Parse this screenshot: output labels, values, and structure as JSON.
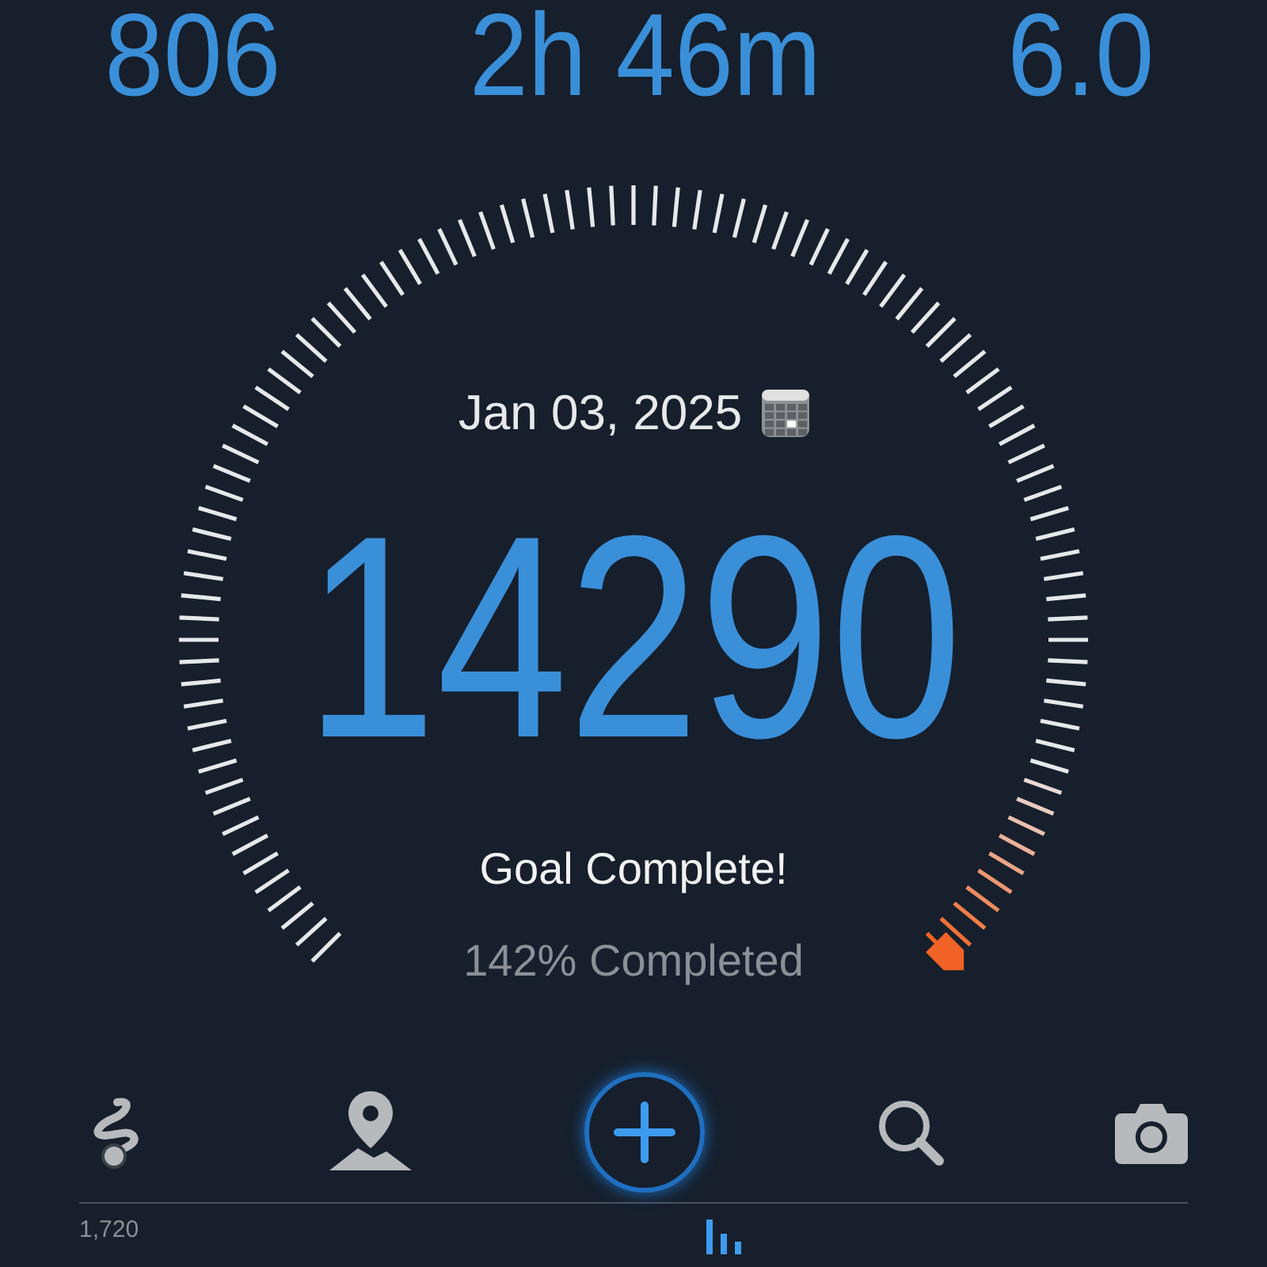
{
  "stats": [
    {
      "value": "806"
    },
    {
      "value": "2h 46m"
    },
    {
      "value": "6.0"
    }
  ],
  "gauge": {
    "date": "Jan 03, 2025",
    "steps": "14290",
    "status": "Goal Complete!",
    "percent": "142% Completed"
  },
  "history": {
    "axis_label": "1,720"
  }
}
